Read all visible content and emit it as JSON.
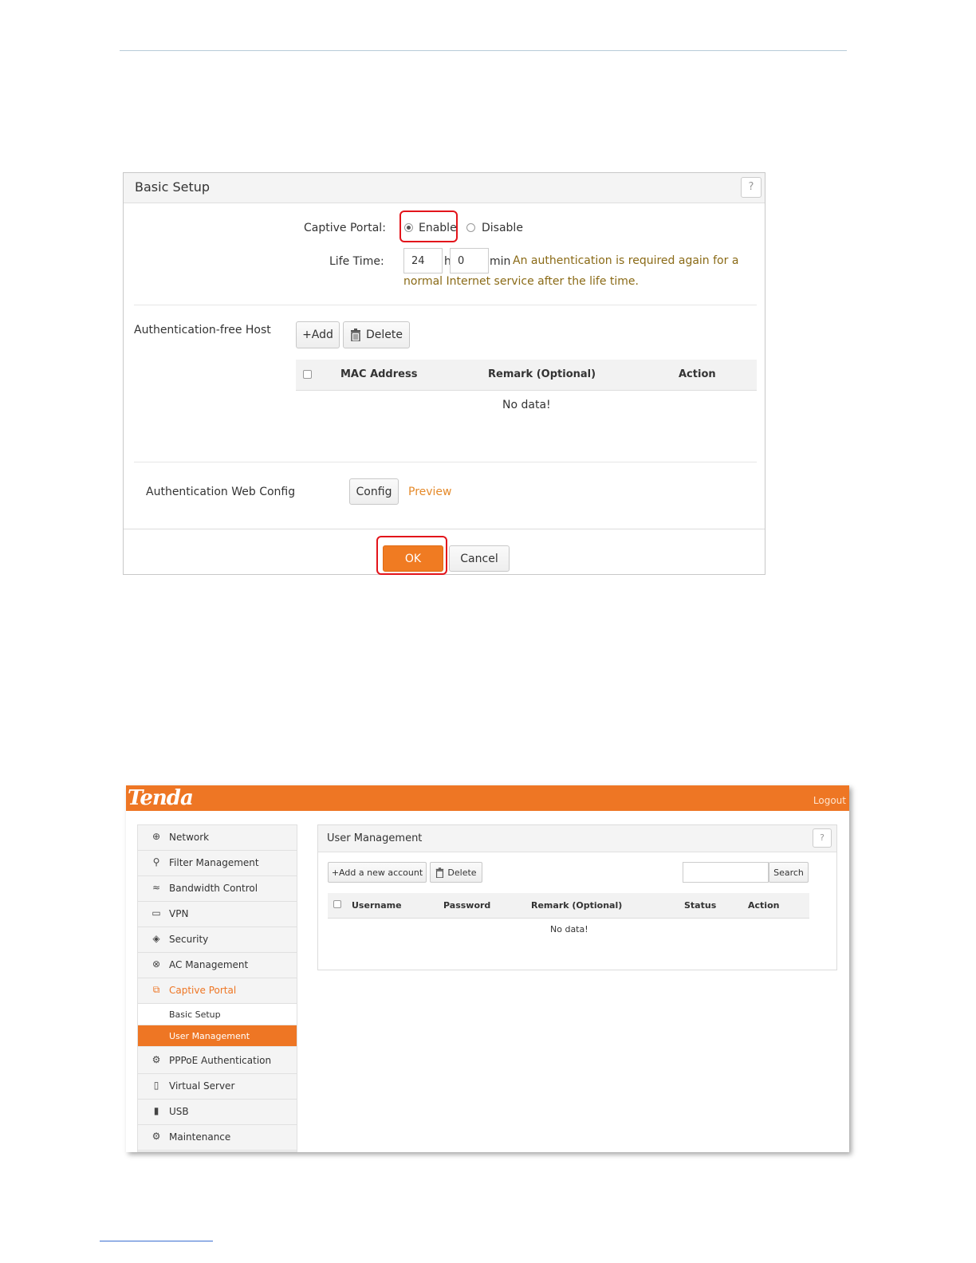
{
  "basic_setup": {
    "title": "Basic Setup",
    "help": "?",
    "captive_portal_label": "Captive Portal:",
    "enable_label": "Enable",
    "disable_label": "Disable",
    "life_time_label": "Life Time:",
    "hours_value": "24",
    "hours_unit": "h",
    "minutes_value": "0",
    "minutes_unit": "min",
    "life_time_hint_1": "An authentication is required again for a",
    "life_time_hint_2": "normal Internet service after the life time.",
    "auth_free_host_label": "Authentication-free Host",
    "add_button": "+Add",
    "delete_button": "Delete",
    "table_headers": [
      "MAC Address",
      "Remark (Optional)",
      "Action"
    ],
    "no_data": "No data!",
    "web_config_label": "Authentication Web Config",
    "config_button": "Config",
    "preview_link": "Preview",
    "ok_button": "OK",
    "cancel_button": "Cancel"
  },
  "tenda_ui": {
    "logo": "Tenda",
    "logout": "Logout",
    "sidebar": [
      {
        "label": "Network",
        "icon": "globe-icon"
      },
      {
        "label": "Filter Management",
        "icon": "user-filter-icon"
      },
      {
        "label": "Bandwidth Control",
        "icon": "wave-icon"
      },
      {
        "label": "VPN",
        "icon": "monitor-icon"
      },
      {
        "label": "Security",
        "icon": "shield-icon"
      },
      {
        "label": "AC Management",
        "icon": "ac-icon"
      },
      {
        "label": "Captive Portal",
        "icon": "portal-icon"
      },
      {
        "label": "PPPoE Authentication",
        "icon": "pppoe-icon"
      },
      {
        "label": "Virtual Server",
        "icon": "server-icon"
      },
      {
        "label": "USB",
        "icon": "usb-icon"
      },
      {
        "label": "Maintenance",
        "icon": "gear-icon"
      }
    ],
    "submenu": [
      "Basic Setup",
      "User Management"
    ],
    "panel_title": "User Management",
    "help": "?",
    "add_account_button": "+Add a new account",
    "delete_button": "Delete",
    "search_placeholder": "",
    "search_button": "Search",
    "table_headers": [
      "Username",
      "Password",
      "Remark (Optional)",
      "Status",
      "Action"
    ],
    "no_data": "No data!"
  },
  "colors": {
    "accent": "#ee7624",
    "highlight": "#e3141b",
    "hint": "#8a6a16"
  }
}
